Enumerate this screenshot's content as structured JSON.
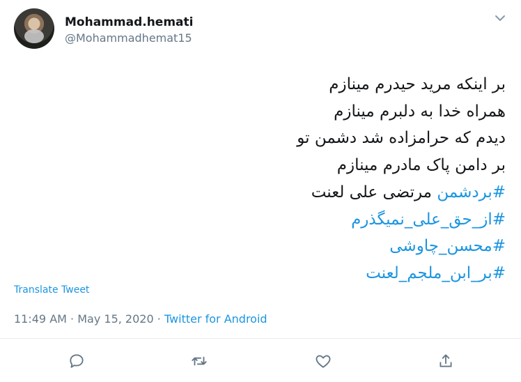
{
  "user": {
    "name": "Mohammad.hemati",
    "handle": "@Mohammadhemat15"
  },
  "tweet": {
    "lines": [
      "بر اینکه مرید حیدرم مینازم",
      "همراه خدا به دلبرم مینازم",
      "دیدم که حرامزاده شد دشمن تو",
      "بر دامن پاک مادرم مینازم"
    ],
    "line5_tag": "#بردشمن",
    "line5_text": " مرتضی علی لعنت",
    "hashtags": [
      "#از_حق_علی_نمیگذرم",
      "#محسن_چاوشی",
      "#بر_ابن_ملجم_لعنت"
    ]
  },
  "translate_label": "Translate Tweet",
  "meta": {
    "time": "11:49 AM",
    "sep1": " · ",
    "date": "May 15, 2020",
    "sep2": " · ",
    "source": "Twitter for Android"
  },
  "icons": [
    "reply-icon",
    "retweet-icon",
    "like-icon",
    "share-icon",
    "chevron-down-icon"
  ],
  "colors": {
    "link": "#1b95e0",
    "secondary": "#657786",
    "text": "#14171a"
  }
}
